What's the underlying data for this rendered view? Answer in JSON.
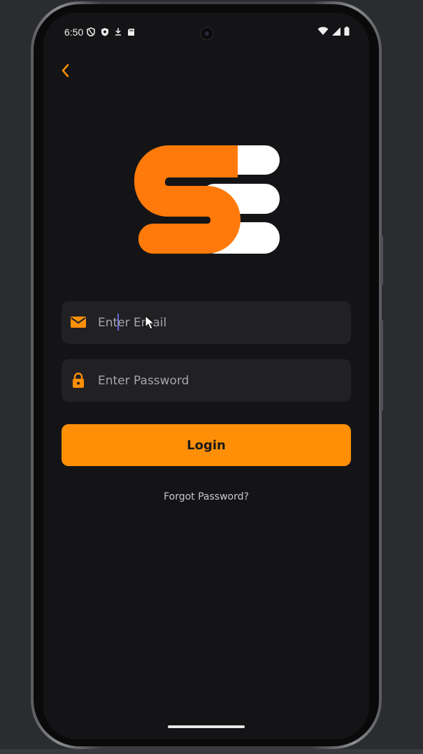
{
  "status_bar": {
    "time": "6:50",
    "left_icons": [
      "vpn-shield-icon",
      "shield-icon",
      "download-icon",
      "sd-card-icon"
    ],
    "right_icons": [
      "wifi-icon",
      "signal-icon",
      "battery-icon"
    ]
  },
  "header": {
    "back_icon": "chevron-left-icon"
  },
  "logo": {
    "primary_color": "#ff7a0a",
    "secondary_color": "#ffffff"
  },
  "form": {
    "email": {
      "placeholder": "Enter Email",
      "value": "",
      "icon": "mail-icon"
    },
    "password": {
      "placeholder": "Enter Password",
      "value": "",
      "icon": "lock-icon"
    },
    "login_label": "Login",
    "forgot_label": "Forgot Password?"
  },
  "colors": {
    "accent": "#ff8f07",
    "background": "#141416",
    "field_background": "#212124"
  }
}
